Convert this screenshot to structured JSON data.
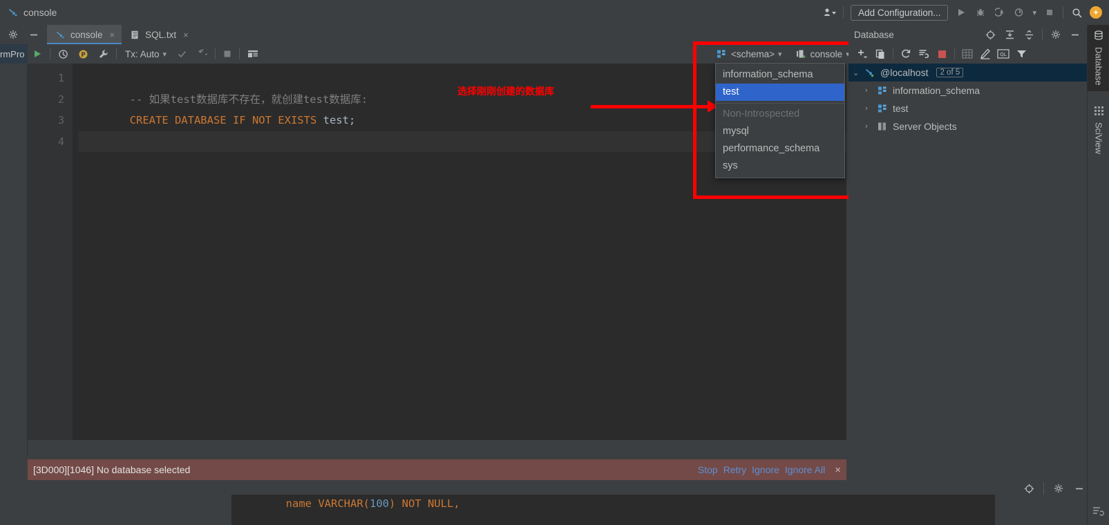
{
  "window": {
    "breadcrumb": "console",
    "breadcrumb_icon": "console-query-icon"
  },
  "top_toolbar": {
    "user_icon": "user-dropdown-icon",
    "add_configuration": "Add Configuration...",
    "icons": [
      "run-icon",
      "debug-icon",
      "run-with-coverage-icon",
      "profile-icon",
      "stop-icon",
      "search-icon"
    ],
    "avatar": "+"
  },
  "editor_tabs": {
    "settings_icon": "gear-icon",
    "minimize_icon": "minimize-icon",
    "tabs": [
      {
        "label": "console",
        "icon": "console-query-icon",
        "active": true,
        "close": "×"
      },
      {
        "label": "SQL.txt",
        "icon": "text-file-icon",
        "active": false,
        "close": "×"
      }
    ]
  },
  "console_toolbar": {
    "left_stub_text": "rmPro",
    "execute_icon": "run-green-triangle-icon",
    "history_icon": "clock-history-icon",
    "param_icon": "parameters-p-icon",
    "wrench_icon": "wrench-icon",
    "tx_label": "Tx: Auto",
    "commit_icon": "commit-check-icon",
    "rollback_icon": "rollback-icon",
    "stop_icon": "stop-square-icon",
    "table_icon": "grid-table-icon"
  },
  "editor": {
    "line_numbers": [
      "1",
      "2",
      "3",
      "4"
    ],
    "lines": [
      {
        "parts": [
          {
            "text": "-- 如果test数据库不存在，就创建test数据库:",
            "cls": "c-comment"
          }
        ]
      },
      {
        "parts": [
          {
            "text": "CREATE DATABASE IF NOT EXISTS ",
            "cls": "c-kw"
          },
          {
            "text": "test;",
            "cls": "c-ident"
          }
        ]
      },
      {
        "parts": [
          {
            "text": "",
            "cls": "c-ident"
          }
        ]
      },
      {
        "parts": [
          {
            "text": "",
            "cls": "c-ident"
          }
        ]
      }
    ]
  },
  "annotation": {
    "text": "选择刚刚创建的数据库",
    "color": "#ff0000"
  },
  "selectors": {
    "schema": {
      "label": "<schema>",
      "icon": "schema-icon",
      "chevron": "⌄"
    },
    "session": {
      "label": "console",
      "icon": "session-icon",
      "chevron": "⌄"
    }
  },
  "schema_dropdown": {
    "items": [
      {
        "label": "information_schema",
        "selected": false,
        "group": false
      },
      {
        "label": "test",
        "selected": true,
        "group": false
      },
      {
        "label": "Non-Introspected",
        "selected": false,
        "group": true
      },
      {
        "label": "mysql",
        "selected": false,
        "group": false
      },
      {
        "label": "performance_schema",
        "selected": false,
        "group": false
      },
      {
        "label": "sys",
        "selected": false,
        "group": false
      }
    ]
  },
  "database_panel": {
    "title": "Database",
    "header_icons": [
      "locate-target-icon",
      "expand-all-icon",
      "collapse-all-icon",
      "gear-icon",
      "minimize-icon"
    ],
    "toolbar_icons": [
      "add-plus-icon",
      "duplicate-icon",
      "refresh-icon",
      "sync-settings-icon",
      "stop-red-icon",
      "table-grid-icon",
      "edit-pencil-icon",
      "ql-console-icon",
      "filter-icon"
    ],
    "tree": [
      {
        "label": "@localhost",
        "icon": "datasource-mysql-icon",
        "arrow": "⌄",
        "level": 1,
        "selected": true,
        "badge": "2 of 5"
      },
      {
        "label": "information_schema",
        "icon": "schema-icon",
        "arrow": "›",
        "level": 2,
        "selected": false,
        "badge": ""
      },
      {
        "label": "test",
        "icon": "schema-icon",
        "arrow": "›",
        "level": 2,
        "selected": false,
        "badge": ""
      },
      {
        "label": "Server Objects",
        "icon": "server-objects-icon",
        "arrow": "›",
        "level": 2,
        "selected": false,
        "badge": ""
      }
    ]
  },
  "right_sidebar": {
    "tabs": [
      {
        "label": "Database",
        "icon": "database-icon",
        "active": true
      },
      {
        "label": "SciView",
        "icon": "sciview-grid-icon",
        "active": false
      }
    ]
  },
  "error_bar": {
    "message": "[3D000][1046] No database selected",
    "links": [
      "Stop",
      "Retry",
      "Ignore",
      "Ignore All"
    ],
    "close": "×",
    "background": "#734a47"
  },
  "bottom": {
    "icons": [
      "locate-target-icon",
      "gear-icon",
      "minimize-icon"
    ],
    "panel_icon": "console-panel-icon",
    "code_line": {
      "pre": "  name VARCHAR(",
      "num": "100",
      "post": ") NOT NULL,"
    }
  }
}
